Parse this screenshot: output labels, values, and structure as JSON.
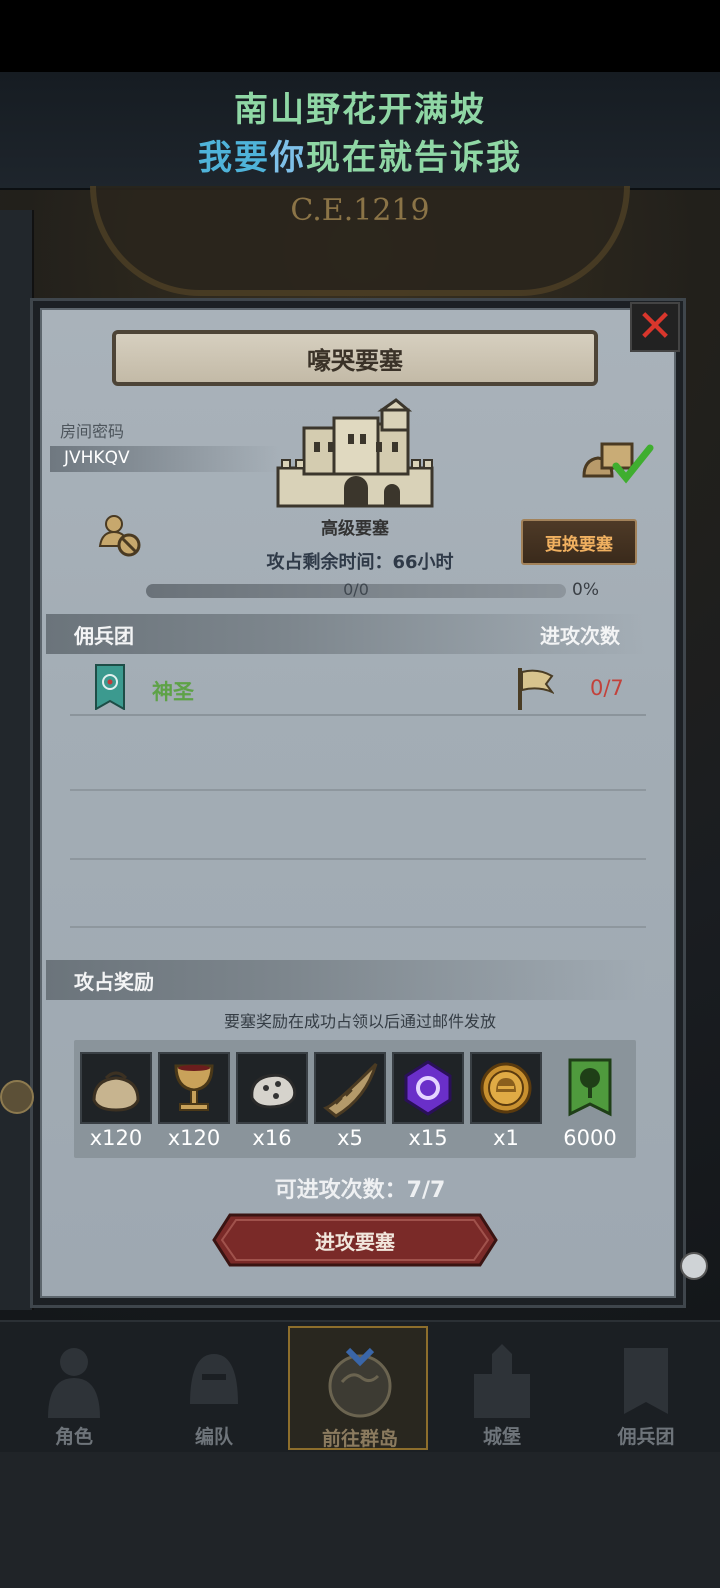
{
  "banner": {
    "line1": "南山野花开满坡",
    "line2_part1": "我要",
    "line2_part2": "你",
    "line2_part3": "现在就告诉我"
  },
  "background": {
    "era_label": "C.E.1219"
  },
  "dialog": {
    "title": "嚎哭要塞",
    "room_code_label": "房间密码",
    "room_code": "JVHKQV",
    "fortress_type": "高级要塞",
    "time_remaining": "攻占剩余时间：66小时",
    "change_button": "更换要塞",
    "progress": {
      "text": "0/0",
      "percent_label": "0%",
      "value": 0
    },
    "mercenary_header": "佣兵团",
    "attack_count_header": "进攻次数",
    "mercenaries": [
      {
        "name": "神圣",
        "attacks": "0/7"
      }
    ],
    "reward_header": "攻占奖励",
    "reward_note": "要塞奖励在成功占领以后通过邮件发放",
    "rewards": [
      {
        "icon": "pouch-icon",
        "qty": "x120"
      },
      {
        "icon": "chalice-icon",
        "qty": "x120"
      },
      {
        "icon": "ore-icon",
        "qty": "x16"
      },
      {
        "icon": "horn-icon",
        "qty": "x5"
      },
      {
        "icon": "purple-gem-icon",
        "qty": "x15"
      },
      {
        "icon": "gold-medal-icon",
        "qty": "x1"
      },
      {
        "icon": "tree-banner-icon",
        "qty": "6000"
      }
    ],
    "attack_remaining": "可进攻次数：7/7",
    "attack_button": "进攻要塞"
  },
  "nav": {
    "items": [
      {
        "label": "角色",
        "icon": "knight-icon"
      },
      {
        "label": "编队",
        "icon": "helmet-icon"
      },
      {
        "label": "前往群岛",
        "icon": "globe-icon"
      },
      {
        "label": "城堡",
        "icon": "castle-icon"
      },
      {
        "label": "佣兵团",
        "icon": "mercenary-icon"
      }
    ],
    "active_index": 2
  },
  "colors": {
    "merc_name": "#5ea247",
    "attack_count": "#c2423b",
    "change_button_text": "#f0b060",
    "close": "#d8362c"
  }
}
